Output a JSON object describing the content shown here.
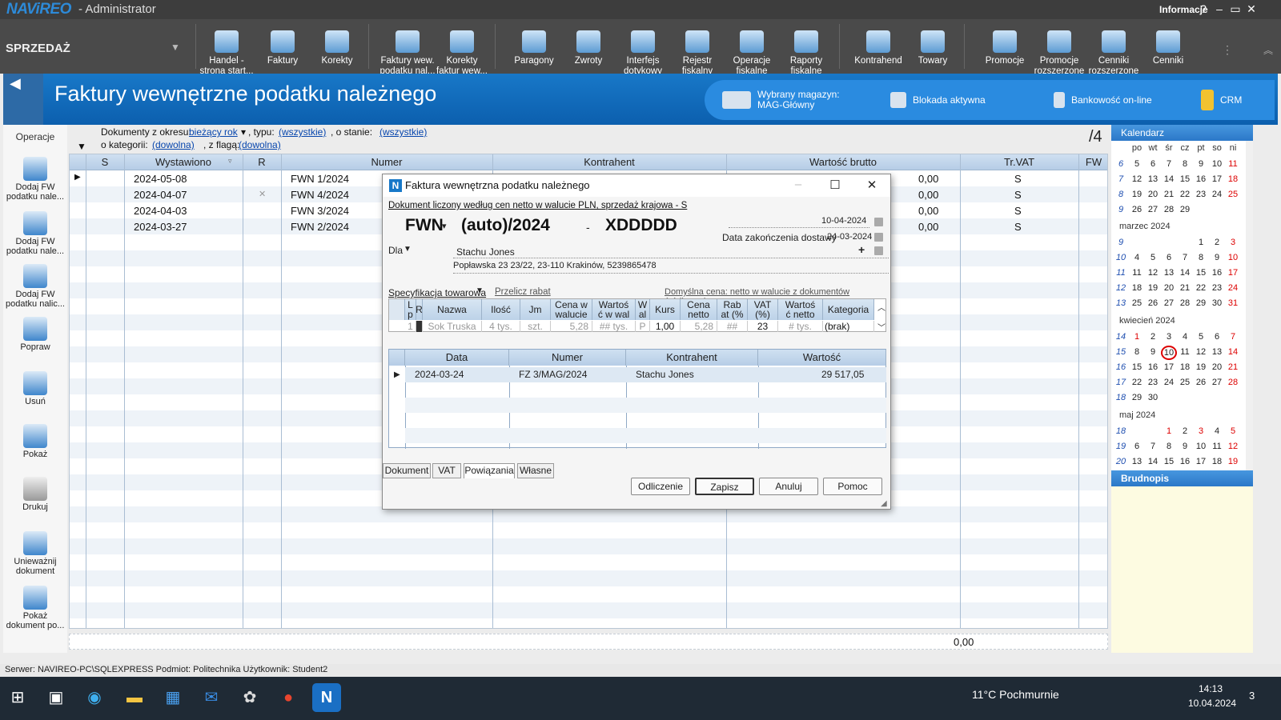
{
  "app": {
    "logo": "NAViREO",
    "title": "- Administrator",
    "info": "Informacje",
    "help": "?",
    "minimize": "–",
    "restore": "▭",
    "close": "✕"
  },
  "ribbon": {
    "module": "SPRZEDAŻ",
    "items": [
      {
        "label": "Handel -\nstrona start..."
      },
      {
        "label": "Faktury"
      },
      {
        "label": "Korekty"
      },
      {
        "label": "Faktury wew.\npodatku nal..."
      },
      {
        "label": "Korekty\nfaktur wew..."
      },
      {
        "label": "Paragony"
      },
      {
        "label": "Zwroty"
      },
      {
        "label": "Interfejs\ndotykowy"
      },
      {
        "label": "Rejestr\nfiskalny"
      },
      {
        "label": "Operacje\nfiskalne"
      },
      {
        "label": "Raporty\nfiskalne"
      },
      {
        "label": "Kontrahend"
      },
      {
        "label": "Towary"
      },
      {
        "label": "Promocje"
      },
      {
        "label": "Promocje\nrozszerzone"
      },
      {
        "label": "Cenniki\nrozszerzone"
      },
      {
        "label": "Cenniki"
      }
    ]
  },
  "banner": {
    "title": "Faktury wewnętrzne podatku należnego",
    "warehouse_label": "Wybrany magazyn:",
    "warehouse_value": "MAG-Główny",
    "lock": "Blokada aktywna",
    "bank": "Bankowość on-line",
    "crm": "CRM"
  },
  "left": {
    "ops": "Operacje",
    "buttons": [
      "Dodaj FW podatku nale...",
      "Dodaj FW podatku nale...",
      "Dodaj FW podatku nalic...",
      "Popraw",
      "Usuń",
      "Pokaż",
      "Drukuj",
      "Unieważnij dokument",
      "Pokaż dokument po..."
    ]
  },
  "filters": {
    "period_label": "Dokumenty z okresu:",
    "period_value": "bieżący rok",
    "type_label": ", typu:",
    "type_value": "(wszystkie)",
    "state_label": ", o stanie:",
    "state_value": "(wszystkie)",
    "cat_label": "o kategorii:",
    "cat_value": "(dowolna)",
    "flag_label": ", z flagą:",
    "flag_value": "(dowolna)",
    "count": "/4"
  },
  "grid": {
    "headers": [
      "S",
      "Wystawiono",
      "R",
      "Numer",
      "Kontrahent",
      "Wartość brutto",
      "Tr.VAT",
      "FW"
    ],
    "rows": [
      {
        "date": "2024-05-08",
        "number": "FWN 1/2024",
        "value": "0,00",
        "vat": "S"
      },
      {
        "date": "2024-04-07",
        "number": "FWN 4/2024",
        "value": "0,00",
        "vat": "S"
      },
      {
        "date": "2024-04-03",
        "number": "FWN 3/2024",
        "value": "0,00",
        "vat": "S"
      },
      {
        "date": "2024-03-27",
        "number": "FWN 2/2024",
        "value": "0,00",
        "vat": "S"
      }
    ],
    "footer_total": "0,00"
  },
  "calendar": {
    "title": "Kalendarz",
    "weekdays": [
      "po",
      "wt",
      "śr",
      "cz",
      "pt",
      "so",
      "ni"
    ],
    "months": [
      "marzec 2024",
      "kwiecień 2024",
      "maj 2024"
    ],
    "today": "10"
  },
  "brudnopis": {
    "title": "Brudnopis"
  },
  "dialog": {
    "title": "Faktura wewnętrzna podatku należnego",
    "subtitle": "Dokument liczony według cen netto w walucie PLN, sprzedaż krajowa - S",
    "prefix": "FWN",
    "number": "(auto)/2024",
    "dash": "-",
    "suffix": "XDDDDD",
    "issue_date": "10-04-2024",
    "delivery_label": "Data zakończenia dostawy",
    "delivery_date": "24-03-2024",
    "for_label": "Dla",
    "contractor_name": "Stachu Jones",
    "contractor_address": "Popławska 23 23/22, 23-110 Krakinów, 5239865478",
    "spec_label": "Specyfikacja towarowa",
    "recalc": "Przelicz rabat",
    "price_note": "Domyślna cena: netto w walucie z dokumentów źródłowych",
    "spec_headers": [
      "L\np",
      "R",
      "Nazwa",
      "Ilość",
      "Jm",
      "Cena w\nwalucie",
      "Wartoś\nć w wal",
      "W\nal",
      "Kurs",
      "Cena\nnetto",
      "Rab\nat (%",
      "VAT\n(%)",
      "Wartoś\nć netto",
      "Kategoria"
    ],
    "spec_row": [
      "1",
      "",
      "Sok Truska",
      "4 tys.",
      "szt.",
      "5,28",
      "## tys.",
      "P",
      "1,00",
      "5,28",
      "##",
      "23",
      "# tys.",
      "(brak)"
    ],
    "rel_headers": [
      "Data",
      "Numer",
      "Kontrahent",
      "Wartość"
    ],
    "rel_row": {
      "date": "2024-03-24",
      "number": "FZ 3/MAG/2024",
      "contractor": "Stachu Jones",
      "value": "29 517,05"
    },
    "tabs": [
      "Dokument",
      "VAT",
      "Powiązania",
      "Własne"
    ],
    "buttons": {
      "odliczenie": "Odliczenie",
      "zapisz": "Zapisz",
      "anuluj": "Anuluj",
      "pomoc": "Pomoc"
    }
  },
  "status": {
    "text": "Serwer: NAVIREO-PC\\SQLEXPRESS   Podmiot: Politechnika   Użytkownik: Student2"
  },
  "taskbar": {
    "weather": "11°C  Pochmurnie",
    "time": "14:13",
    "date": "10.04.2024",
    "notifications": "3"
  }
}
